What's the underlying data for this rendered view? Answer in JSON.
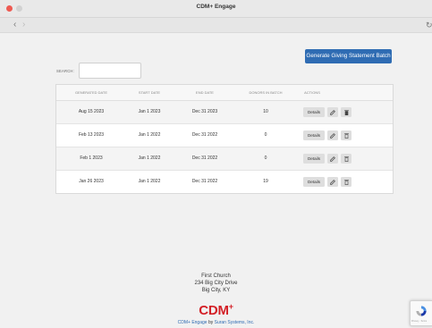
{
  "window": {
    "title": "CDM+ Engage"
  },
  "nav": {
    "back": "‹",
    "forward": "›",
    "refresh": "↻"
  },
  "toolbar": {
    "generate_label": "Generate Giving Statement Batch"
  },
  "search": {
    "label": "SEARCH:",
    "value": "",
    "placeholder": ""
  },
  "table": {
    "headers": [
      "GENERATED DATE",
      "START DATE",
      "END DATE",
      "DONORS IN BATCH",
      "ACTIONS"
    ],
    "rows": [
      {
        "generated": "Aug 15 2023",
        "start": "Jan 1 2023",
        "end": "Dec 31 2023",
        "donors": "10",
        "details": "Details"
      },
      {
        "generated": "Feb 13 2023",
        "start": "Jan 1 2022",
        "end": "Dec 31 2022",
        "donors": "0",
        "details": "Details"
      },
      {
        "generated": "Feb 1 2023",
        "start": "Jan 1 2022",
        "end": "Dec 31 2022",
        "donors": "0",
        "details": "Details"
      },
      {
        "generated": "Jan 26 2023",
        "start": "Jan 1 2022",
        "end": "Dec 31 2022",
        "donors": "19",
        "details": "Details"
      }
    ]
  },
  "footer": {
    "name": "First Church",
    "address1": "234 Big City Drive",
    "address2": "Big City, KY",
    "logo_text": "CDM",
    "logo_plus": "+",
    "credit_product": "CDM+ Engage",
    "credit_by": " by ",
    "credit_company": "Suran Systems, Inc."
  },
  "recaptcha": {
    "text": "Privacy - Terms"
  },
  "colors": {
    "accent": "#2f6cb3",
    "brand_red": "#d31f26"
  }
}
